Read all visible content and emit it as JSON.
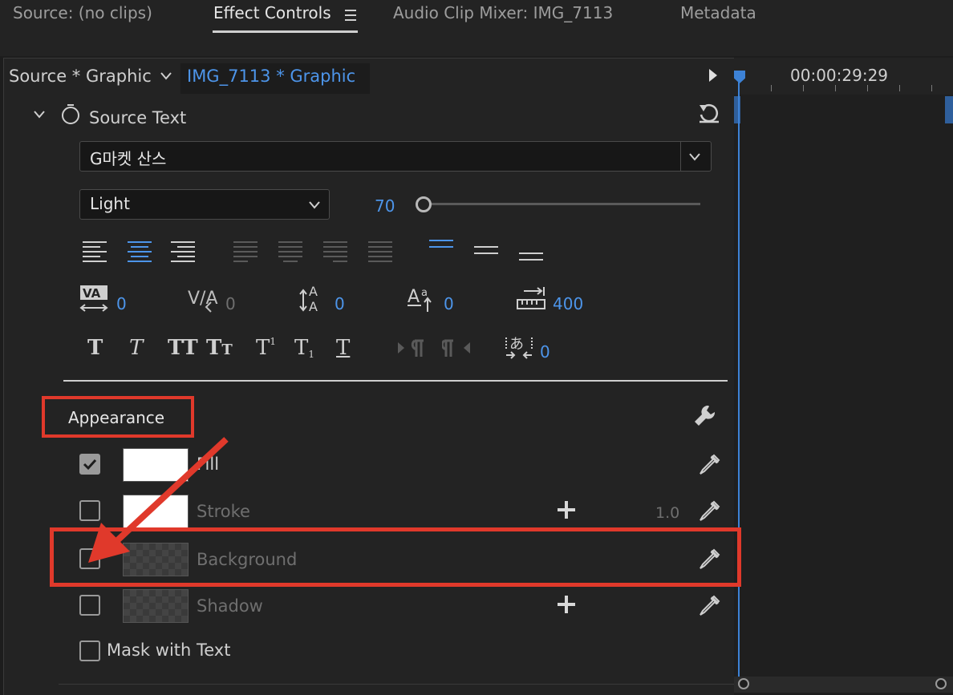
{
  "top_tabs": {
    "source": "Source: (no clips)",
    "effect_controls": "Effect Controls",
    "audio_mixer": "Audio Clip Mixer: IMG_7113",
    "metadata": "Metadata"
  },
  "sub_tabs": {
    "master": "Source * Graphic",
    "clip": "IMG_7113 * Graphic"
  },
  "timeline": {
    "timecode": "00:00:29:29"
  },
  "source_text": {
    "label": "Source Text",
    "font": "G마켓 산스",
    "weight": "Light",
    "size": "70",
    "size_slider_fraction": 0.0
  },
  "text_metrics": {
    "kerning": "0",
    "tracking": "0",
    "leading": "0",
    "baseline_shift": "0",
    "tab_width": "400",
    "tsume": "0"
  },
  "appearance": {
    "label": "Appearance",
    "fill": "Fill",
    "stroke": "Stroke",
    "stroke_width": "1.0",
    "background": "Background",
    "shadow": "Shadow",
    "mask": "Mask with Text"
  },
  "colors": {
    "accent": "#4d95ea",
    "annotation": "#e0392b"
  }
}
